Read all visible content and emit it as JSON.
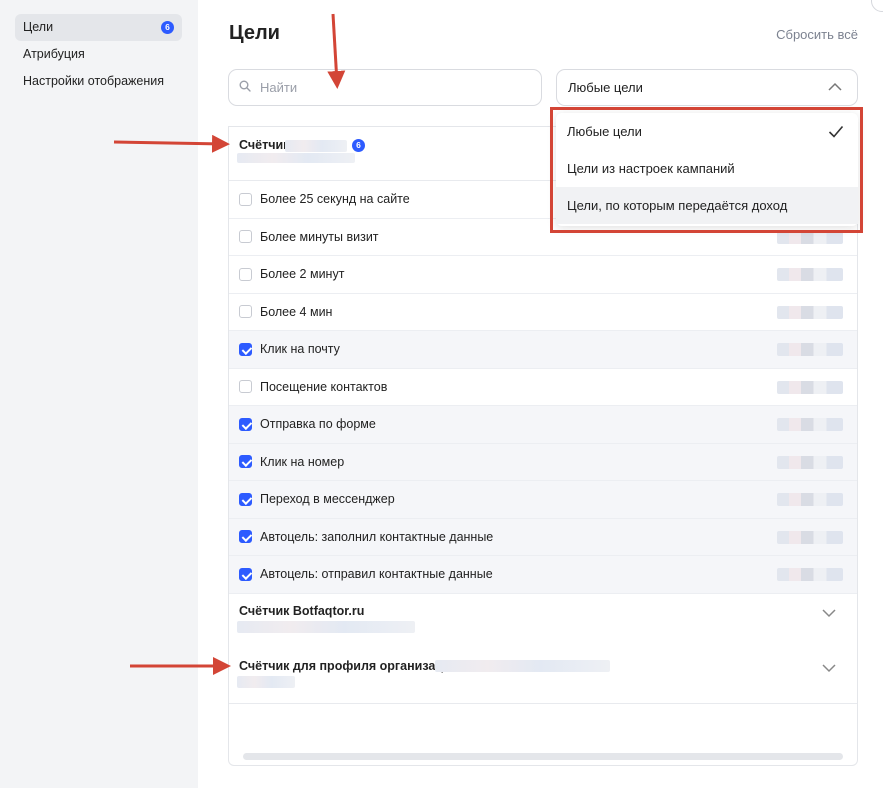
{
  "sidebar": {
    "items": [
      {
        "label": "Цели",
        "badge": "6",
        "active": true
      },
      {
        "label": "Атрибуция"
      },
      {
        "label": "Настройки отображения"
      }
    ]
  },
  "header": {
    "title": "Цели",
    "reset_label": "Сбросить всё"
  },
  "search": {
    "placeholder": "Найти"
  },
  "filter": {
    "selected": "Любые цели",
    "options": [
      {
        "label": "Любые цели",
        "selected": true
      },
      {
        "label": "Цели из настроек кампаний"
      },
      {
        "label": "Цели, по которым передаётся доход",
        "hovered": true
      }
    ]
  },
  "counters": [
    {
      "name": "Счётчик",
      "badge": "6",
      "goals": [
        {
          "label": "Более 25 секунд на сайте",
          "checked": false
        },
        {
          "label": "Более минуты визит",
          "checked": false
        },
        {
          "label": "Более 2 минут",
          "checked": false
        },
        {
          "label": "Более 4 мин",
          "checked": false
        },
        {
          "label": "Клик на почту",
          "checked": true
        },
        {
          "label": "Посещение контактов",
          "checked": false
        },
        {
          "label": "Отправка по форме",
          "checked": true
        },
        {
          "label": "Клик на номер",
          "checked": true
        },
        {
          "label": "Переход в мессенджер",
          "checked": true
        },
        {
          "label": "Автоцель: заполнил контактные данные",
          "checked": true
        },
        {
          "label": "Автоцель: отправил контактные данные",
          "checked": true
        }
      ]
    },
    {
      "name": "Счётчик Botfaqtor.ru"
    },
    {
      "name": "Счётчик для профиля организации"
    }
  ],
  "colors": {
    "accent": "#2d5bff",
    "annotation": "#d34536"
  },
  "icons": [
    "search-icon",
    "chevron-up-icon",
    "checkmark-icon",
    "chevron-down-icon",
    "annotation-arrow-icon"
  ]
}
